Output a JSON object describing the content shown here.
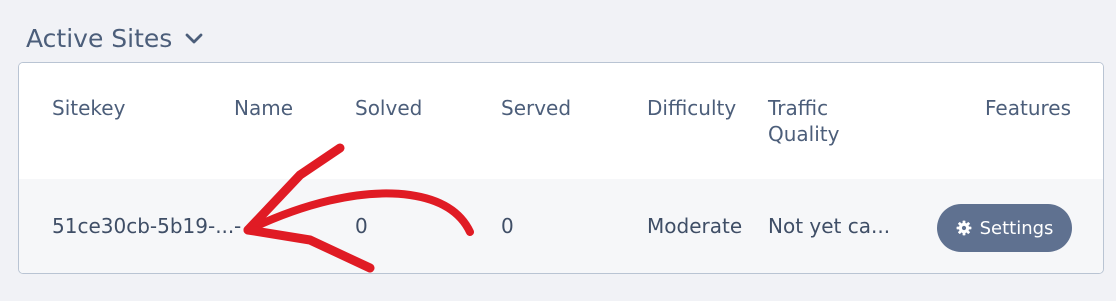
{
  "section": {
    "title": "Active Sites",
    "toggle_icon": "chevron-down-icon"
  },
  "table": {
    "columns": {
      "sitekey": "Sitekey",
      "name": "Name",
      "solved": "Solved",
      "served": "Served",
      "difficulty": "Difficulty",
      "traffic_quality_line1": "Traffic",
      "traffic_quality_line2": "Quality",
      "features": "Features"
    },
    "rows": [
      {
        "sitekey": "51ce30cb-5b19-...",
        "name": "-",
        "solved": "0",
        "served": "0",
        "difficulty": "Moderate",
        "traffic_quality": "Not yet ca...",
        "settings_label": "Settings",
        "settings_icon": "gear-icon"
      }
    ]
  },
  "colors": {
    "accent": "#5f7190",
    "text": "#4c5e7a",
    "annotation": "#e01b24"
  },
  "annotation": {
    "type": "red-arrow",
    "points_to": "name"
  }
}
